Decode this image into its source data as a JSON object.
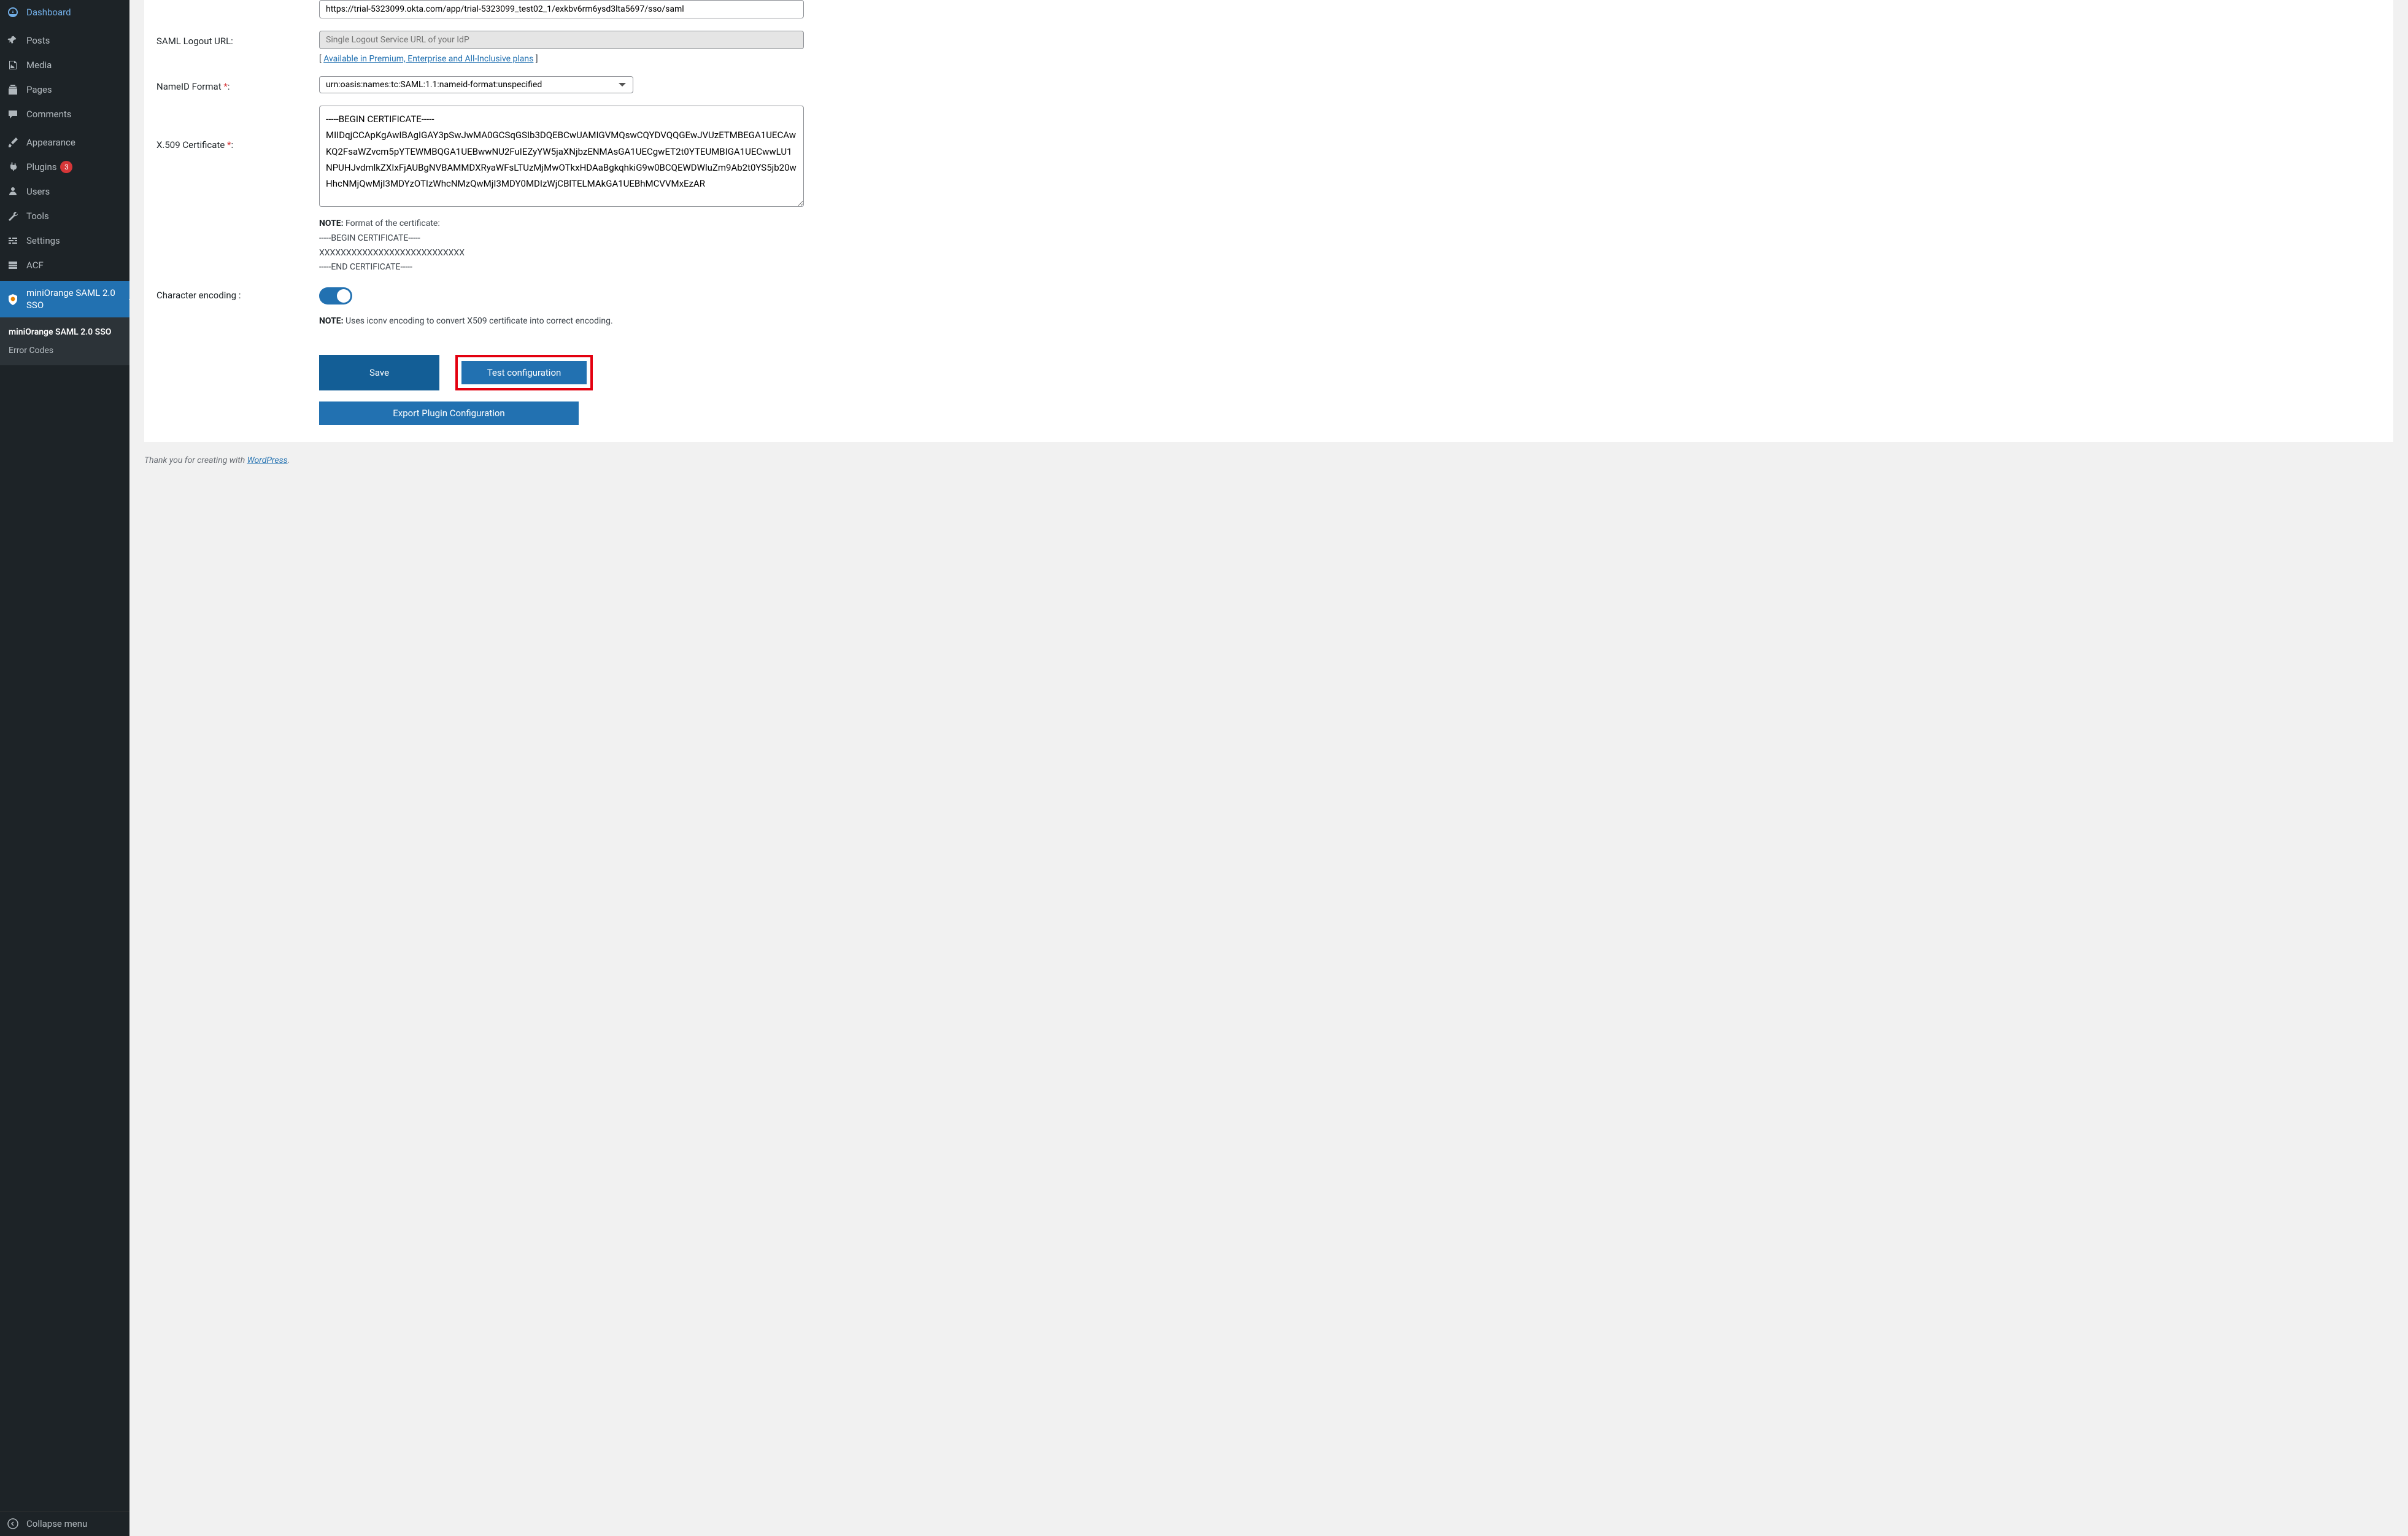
{
  "sidebar": {
    "items": [
      {
        "label": "Dashboard",
        "name": "sidebar-item-dashboard",
        "icon": "dashboard"
      },
      {
        "label": "Posts",
        "name": "sidebar-item-posts",
        "icon": "pin"
      },
      {
        "label": "Media",
        "name": "sidebar-item-media",
        "icon": "media"
      },
      {
        "label": "Pages",
        "name": "sidebar-item-pages",
        "icon": "pages"
      },
      {
        "label": "Comments",
        "name": "sidebar-item-comments",
        "icon": "comment"
      },
      {
        "label": "Appearance",
        "name": "sidebar-item-appearance",
        "icon": "brush"
      },
      {
        "label": "Plugins",
        "name": "sidebar-item-plugins",
        "icon": "plug",
        "badge": "3"
      },
      {
        "label": "Users",
        "name": "sidebar-item-users",
        "icon": "user"
      },
      {
        "label": "Tools",
        "name": "sidebar-item-tools",
        "icon": "wrench"
      },
      {
        "label": "Settings",
        "name": "sidebar-item-settings",
        "icon": "sliders"
      },
      {
        "label": "ACF",
        "name": "sidebar-item-acf",
        "icon": "acf"
      },
      {
        "label": "miniOrange SAML 2.0 SSO",
        "name": "sidebar-item-miniorange",
        "icon": "shield",
        "active": true
      }
    ],
    "sub": [
      {
        "label": "miniOrange SAML 2.0 SSO",
        "current": true
      },
      {
        "label": "Error Codes",
        "current": false
      }
    ],
    "collapse": "Collapse menu"
  },
  "form": {
    "login_url": {
      "value": "https://trial-5323099.okta.com/app/trial-5323099_test02_1/exkbv6rm6ysd3lta5697/sso/saml"
    },
    "logout_url": {
      "label": "SAML Logout URL:",
      "placeholder": "Single Logout Service URL of your IdP",
      "upgrade_prefix": "[ ",
      "upgrade_link": "Available in Premium, Enterprise and All-Inclusive plans",
      "upgrade_suffix": " ]"
    },
    "nameid": {
      "label": "NameID Format ",
      "req": "*",
      "label_suffix": ":",
      "value": "urn:oasis:names:tc:SAML:1.1:nameid-format:unspecified"
    },
    "cert": {
      "label": "X.509 Certificate ",
      "req": "*",
      "label_suffix": ":",
      "value": "-----BEGIN CERTIFICATE-----\nMIIDqjCCApKgAwIBAgIGAY3pSwJwMA0GCSqGSIb3DQEBCwUAMIGVMQswCQYDVQQGEwJVUzETMBEGA1UECAwKQ2FsaWZvcm5pYTEWMBQGA1UEBwwNU2FuIEZyYW5jaXNjbzENMAsGA1UECgwET2t0YTEUMBIGA1UECwwLU1NPUHJvdmlkZXIxFjAUBgNVBAMMDXRyaWFsLTUzMjMwOTkxHDAaBgkqhkiG9w0BCQEWDWluZm9Ab2t0YS5jb20wHhcNMjQwMjI3MDYzOTIzWhcNMzQwMjI3MDY0MDIzWjCBlTELMAkGA1UEBhMCVVMxEzAR",
      "note_label": "NOTE:",
      "note_text": " Format of the certificate:",
      "note_line1": "-----BEGIN CERTIFICATE-----",
      "note_line2": "XXXXXXXXXXXXXXXXXXXXXXXXXXX",
      "note_line3": "-----END CERTIFICATE-----"
    },
    "encoding": {
      "label": "Character encoding :",
      "note_label": "NOTE:",
      "note_text": " Uses iconv encoding to convert X509 certificate into correct encoding."
    },
    "buttons": {
      "save": "Save",
      "test": "Test configuration",
      "export": "Export Plugin Configuration"
    }
  },
  "footer": {
    "prefix": "Thank you for creating with ",
    "link": "WordPress",
    "suffix": "."
  }
}
